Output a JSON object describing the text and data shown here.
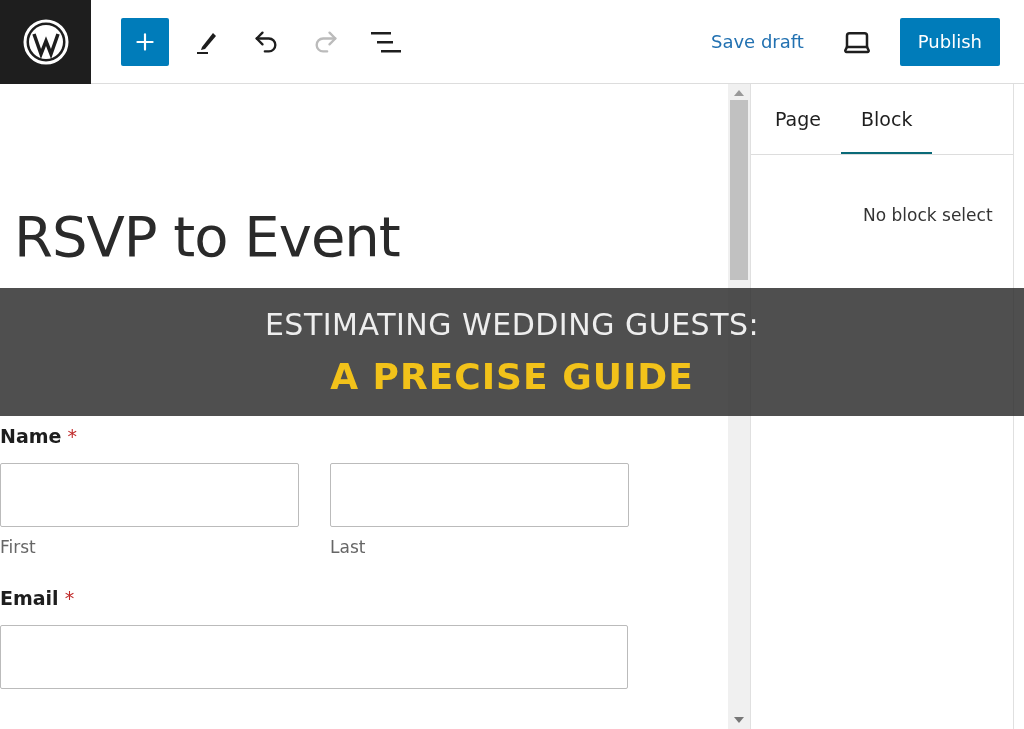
{
  "toolbar": {
    "add_button": {
      "pressed": true
    },
    "undo": {
      "disabled": false
    },
    "redo": {
      "disabled": true
    },
    "save_draft": "Save draft",
    "publish": "Publish"
  },
  "editor": {
    "title": "RSVP to Event",
    "fields": [
      {
        "label": "Name",
        "required_mark": "*",
        "inputs": [
          {
            "sublabel": "First"
          },
          {
            "sublabel": "Last"
          }
        ]
      },
      {
        "label": "Email",
        "required_mark": "*"
      }
    ]
  },
  "sidebar": {
    "tabs": [
      {
        "label": "Page",
        "selected": false
      },
      {
        "label": "Block",
        "selected": true
      }
    ],
    "message": "No block select"
  },
  "banner": {
    "title": "ESTIMATING WEDDING GUESTS:",
    "subtitle": "A PRECISE GUIDE"
  }
}
